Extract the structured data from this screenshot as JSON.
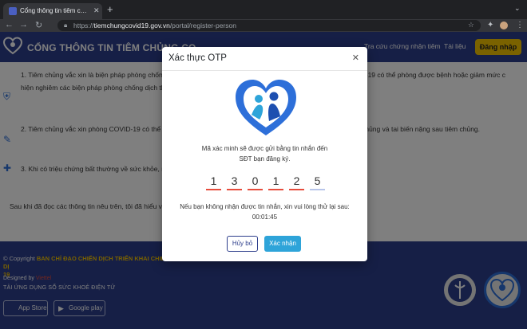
{
  "browser": {
    "tab_title": "Cổng thông tin tiêm chủng Covid",
    "url_domain": "tiemchungcovid19.gov.vn",
    "url_prefix": "https://",
    "url_path": "/portal/register-person"
  },
  "header": {
    "site_title": "CỔNG THÔNG TIN TIÊM CHỦNG CO",
    "nav": [
      "Tra cứu chứng nhận tiêm",
      "Tài liệu"
    ],
    "login_label": "Đăng nhập"
  },
  "content": {
    "items": [
      "1. Tiêm chủng vắc xin là biện pháp phòng chống dịch                                                                                                         nh hoàn toàn. Người được tiêm chủng vắc xin phòng COVID-19 có thể phòng được bệnh hoặc giảm mức                                                                             c hiện nghiêm các biện pháp phòng chống dịch theo quy định.",
      "2. Tiêm chủng vắc xin phòng COVID-19 có thể gây ra                                                                                                          hoặc toàn thân, bao gồm phản ứng thông thường sau tiêm chủng và tai biến nặng sau tiêm chủng.",
      "3. Khi có triệu chứng bất thường về sức khỏe, người                                                                                                         ám và điều trị kịp thời."
    ],
    "agree_text": "Sau khi đã đọc các thông tin nêu trên, tôi đã hiểu về các"
  },
  "footer": {
    "copyright_prefix": "© Copyright",
    "copyright_org": "BAN CHỈ ĐẠO CHIẾN DỊCH TRIỂN KHAI CHIẾN DỊ",
    "copyright_year": "19",
    "designed_by": "Designed by",
    "designer": "Viettel",
    "app_title": "TẢI ỨNG DỤNG SỔ SỨC KHOẺ ĐIỆN TỬ",
    "app_store": "App Store",
    "google_play": "Google play"
  },
  "modal": {
    "title": "Xác thực OTP",
    "message_line1": "Mã xác minh sẽ được gửi bằng tin nhắn đến",
    "message_line2": "SĐT bạn đăng ký.",
    "otp_digits": [
      "1",
      "3",
      "0",
      "1",
      "2",
      "5"
    ],
    "resend_line1": "Nếu bạn không nhận được tin nhắn, xin vui lòng thử lại sau:",
    "countdown": "00:01:45",
    "cancel_label": "Hủy bỏ",
    "confirm_label": "Xác nhận"
  },
  "colors": {
    "brand_blue": "#2d3e8c",
    "login_yellow": "#f5c400",
    "confirm_blue": "#2ea4d9",
    "otp_underline": "#e74c3c"
  }
}
